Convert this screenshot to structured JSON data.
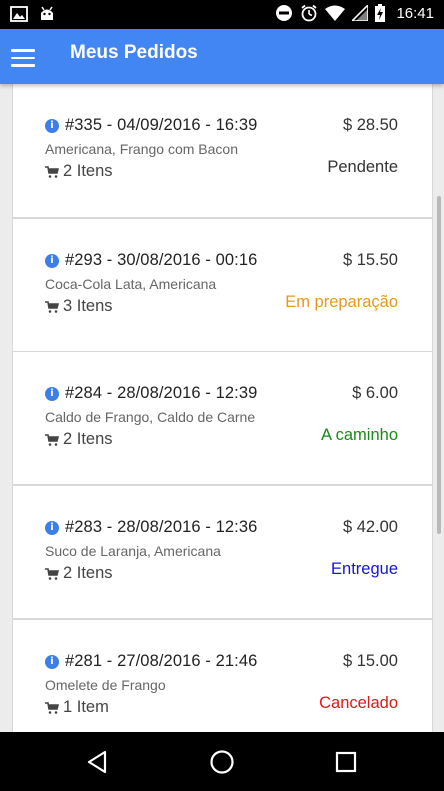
{
  "status_bar": {
    "time": "16:41",
    "icons": [
      "image-icon",
      "android-icon",
      "do-not-disturb-icon",
      "alarm-icon",
      "wifi-icon",
      "signal-icon",
      "battery-charging-icon"
    ]
  },
  "app_bar": {
    "title": "Meus Pedidos",
    "menu_icon": "hamburger-menu-icon",
    "color": "#4286f4"
  },
  "orders": [
    {
      "title": "#335 - 04/09/2016 - 16:39",
      "price": "$ 28.50",
      "items_desc": "Americana, Frango com Bacon",
      "count": "2 Itens",
      "status": "Pendente",
      "status_color": "#333333"
    },
    {
      "title": "#293 - 30/08/2016 - 00:16",
      "price": "$ 15.50",
      "items_desc": "Coca-Cola Lata, Americana",
      "count": "3 Itens",
      "status": "Em preparação",
      "status_color": "#e39a1d"
    },
    {
      "title": "#284 - 28/08/2016 - 12:39",
      "price": "$ 6.00",
      "items_desc": "Caldo de Frango, Caldo de Carne",
      "count": "2 Itens",
      "status": "A caminho",
      "status_color": "#1a8a1a"
    },
    {
      "title": "#283 - 28/08/2016 - 12:36",
      "price": "$ 42.00",
      "items_desc": "Suco de Laranja, Americana",
      "count": "2 Itens",
      "status": "Entregue",
      "status_color": "#1515d6"
    },
    {
      "title": "#281 - 27/08/2016 - 21:46",
      "price": "$ 15.00",
      "items_desc": "Omelete de Frango",
      "count": "1 Item",
      "status": "Cancelado",
      "status_color": "#e01818"
    }
  ],
  "nav_bar": {
    "buttons": [
      "back-icon",
      "home-icon",
      "recents-icon"
    ]
  }
}
